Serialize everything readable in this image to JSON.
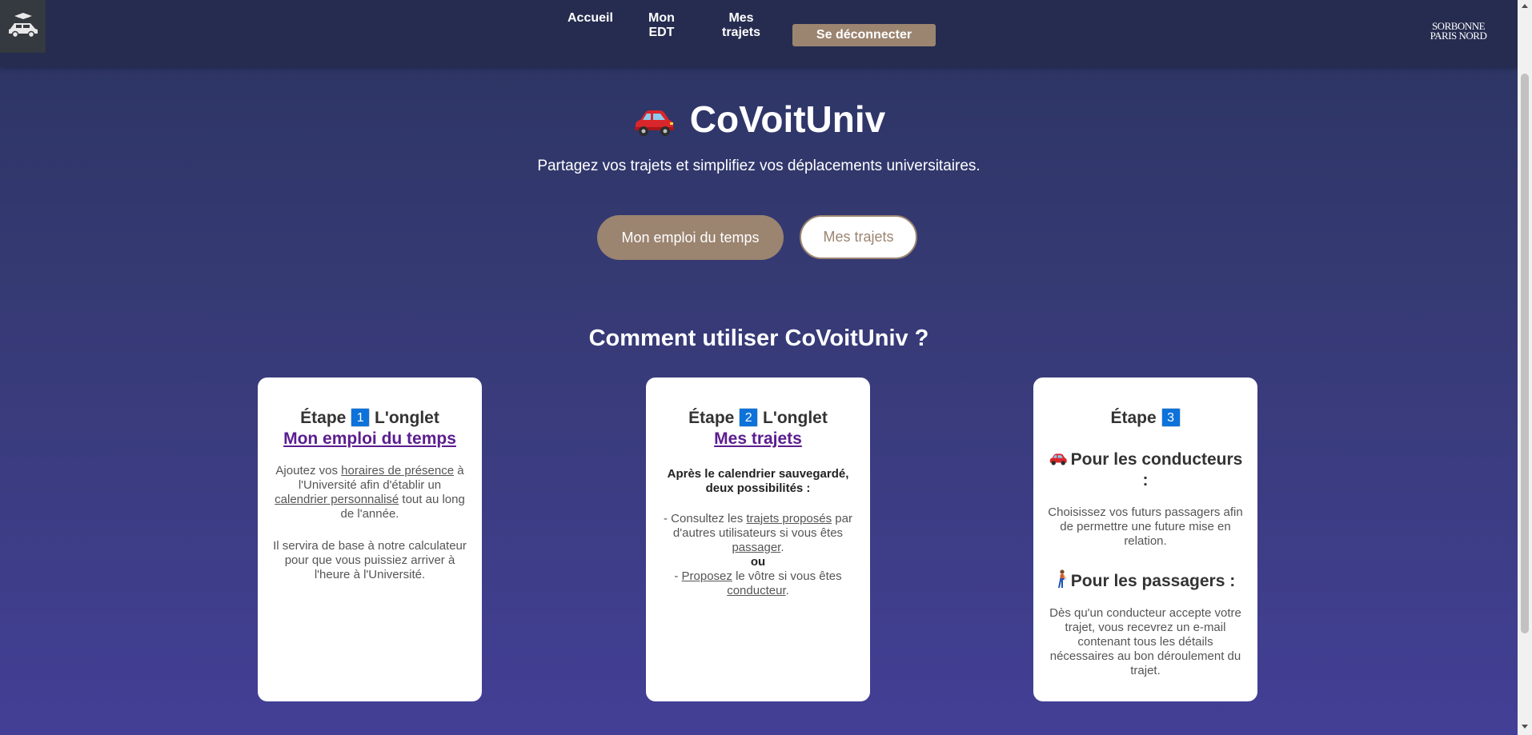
{
  "nav": {
    "home": "Accueil",
    "edt_line1": "Mon",
    "edt_line2": "EDT",
    "trips_line1": "Mes",
    "trips_line2": "trajets",
    "logout": "Se déconnecter",
    "university_logo_line1": "SORBONNE",
    "university_logo_line2": "PARIS NORD"
  },
  "hero": {
    "title": "CoVoitUniv",
    "subtitle": "Partagez vos trajets et simplifiez vos déplacements universitaires.",
    "btn_schedule": "Mon emploi du temps",
    "btn_trips": "Mes trajets"
  },
  "howto": {
    "title": "Comment utiliser CoVoitUniv ?"
  },
  "step1": {
    "etape": "Étape",
    "num": "1",
    "onglet": "L'onglet",
    "tab": "Mon emploi du temps",
    "p1_a": "Ajoutez vos ",
    "p1_u1": "horaires de présence",
    "p1_b": " à l'Université afin d'établir un ",
    "p1_u2": "calendrier personnalisé",
    "p1_c": " tout au long de l'année.",
    "p2": "Il servira de base à notre calculateur pour que vous puissiez arriver à l'heure à l'Université."
  },
  "step2": {
    "etape": "Étape",
    "num": "2",
    "onglet": "L'onglet",
    "tab": "Mes trajets",
    "intro": "Après le calendrier sauvegardé, deux possibilités :",
    "l1_a": "- Consultez les ",
    "l1_u": "trajets proposés",
    "l1_b": " par d'autres utilisateurs si vous êtes ",
    "l1_u2": "passager",
    "l1_c": ".",
    "ou": "ou",
    "l2_a": "- ",
    "l2_u": "Proposez",
    "l2_b": " le vôtre si vous êtes ",
    "l2_u2": "conducteur",
    "l2_c": "."
  },
  "step3": {
    "etape": "Étape",
    "num": "3",
    "drivers_title": "Pour les conducteurs :",
    "drivers_text": "Choisissez vos futurs passagers afin de permettre une future mise en relation.",
    "passengers_title": "Pour les passagers :",
    "passengers_text": "Dès qu'un conducteur accepte votre trajet, vous recevrez un e-mail contenant tous les détails nécessaires au bon déroulement du trajet."
  },
  "icons": [
    "car-icon",
    "walking-person-icon",
    "app-logo-icon"
  ],
  "colors": {
    "accent": "#9b8470",
    "link": "#5b1d8f",
    "step_badge": "#0d72d9",
    "topbar": "#252c4f"
  }
}
